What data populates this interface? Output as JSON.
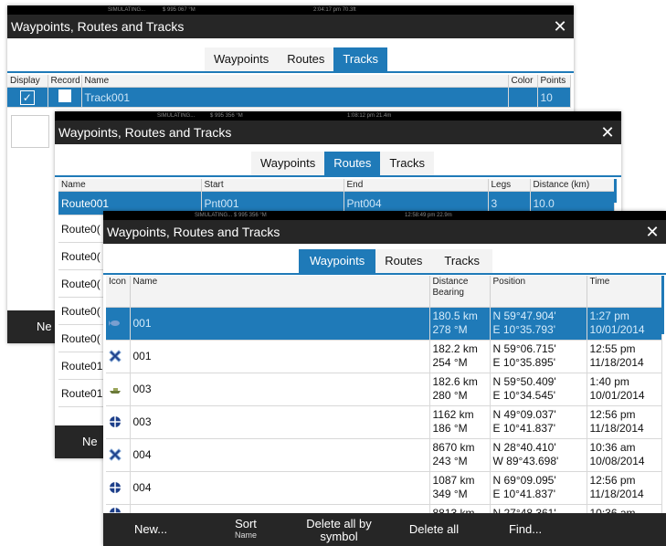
{
  "back_window": {
    "status": {
      "left": "SIMULATING...",
      "mid": "$ 995 067 °M",
      "time": "2:04:17 pm   70.3ft"
    },
    "title": "Waypoints, Routes and Tracks",
    "tabs": [
      "Waypoints",
      "Routes",
      "Tracks"
    ],
    "active_tab": "Tracks",
    "columns": [
      "Display",
      "Record",
      "Name",
      "Color",
      "Points"
    ],
    "row": {
      "name": "Track001",
      "points": "10"
    },
    "bottom_button": "Ne"
  },
  "middle_window": {
    "status": {
      "left": "SIMULATING...",
      "mid": "$ 995 356 °M",
      "time": "1:08:12 pm   21.4m"
    },
    "title": "Waypoints, Routes and Tracks",
    "tabs": [
      "Waypoints",
      "Routes",
      "Tracks"
    ],
    "active_tab": "Routes",
    "columns": [
      "Name",
      "Start",
      "End",
      "Legs",
      "Distance (km)"
    ],
    "rows": [
      "Route001",
      "Route0(",
      "Route0(",
      "Route0(",
      "Route0(",
      "Route0(",
      "Route01",
      "Route01"
    ],
    "first_row": {
      "start": "Pnt001",
      "end": "Pnt004",
      "legs": "3",
      "distance": "10.0"
    },
    "bottom_button": "Ne"
  },
  "front_window": {
    "status": {
      "left": "SIMULATING...",
      "mid": "$ 995 356 °M",
      "time": "12:58:49 pm   22.9m"
    },
    "title": "Waypoints, Routes and Tracks",
    "tabs": [
      "Waypoints",
      "Routes",
      "Tracks"
    ],
    "active_tab": "Waypoints",
    "columns": {
      "icon": "Icon",
      "name": "Name",
      "dist_a": "Distance",
      "dist_b": "Bearing",
      "position": "Position",
      "time": "Time"
    },
    "rows": [
      {
        "icon": "fish-icon",
        "name": "001",
        "distance": "180.5 km",
        "bearing": "278 °M",
        "lat": "N  59°47.904'",
        "lon": "E  10°35.793'",
        "time": "1:27 pm",
        "date": "10/01/2014",
        "selected": true
      },
      {
        "icon": "cross-icon",
        "name": "001",
        "distance": "182.2 km",
        "bearing": "254 °M",
        "lat": "N  59°06.715'",
        "lon": "E  10°35.895'",
        "time": "12:55 pm",
        "date": "11/18/2014"
      },
      {
        "icon": "boat-icon",
        "name": "003",
        "distance": "182.6 km",
        "bearing": "280 °M",
        "lat": "N  59°50.409'",
        "lon": "E  10°34.545'",
        "time": "1:40 pm",
        "date": "10/01/2014"
      },
      {
        "icon": "diamond-icon",
        "name": "003",
        "distance": "1162 km",
        "bearing": "186 °M",
        "lat": "N  49°09.037'",
        "lon": "E  10°41.837'",
        "time": "12:56 pm",
        "date": "11/18/2014"
      },
      {
        "icon": "cross-icon",
        "name": "004",
        "distance": "8670 km",
        "bearing": "243 °M",
        "lat": "N  28°40.410'",
        "lon": "W  89°43.698'",
        "time": "10:36 am",
        "date": "10/08/2014"
      },
      {
        "icon": "diamond-icon",
        "name": "004",
        "distance": "1087 km",
        "bearing": "349 °M",
        "lat": "N  69°09.095'",
        "lon": "E  10°41.837'",
        "time": "12:56 pm",
        "date": "11/18/2014"
      },
      {
        "icon": "diamond-icon",
        "name": "",
        "distance": "8813 km",
        "bearing": "",
        "lat": "N  27°48.361'",
        "lon": "",
        "time": "10:36 am",
        "date": ""
      }
    ],
    "buttons": {
      "new": "New...",
      "sort": "Sort",
      "sort_sub": "Name",
      "delete_symbol": "Delete all by",
      "delete_symbol_sub": "symbol",
      "delete_all": "Delete all",
      "find": "Find..."
    }
  },
  "colors": {
    "accent": "#1f7ab8",
    "bar": "#262626"
  }
}
